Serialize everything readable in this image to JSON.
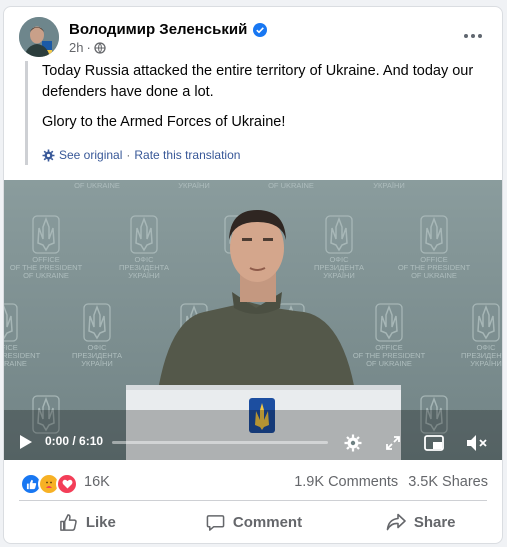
{
  "post": {
    "author": "Володимир Зеленський",
    "time": "2h",
    "verified_icon": "verified-badge-icon",
    "privacy_icon": "globe-icon"
  },
  "translation": {
    "paragraph_1": "Today Russia attacked the entire territory of Ukraine. And today our defenders have done a lot.",
    "paragraph_2": "Glory to the Armed Forces of Ukraine!",
    "see_original": "See original",
    "separator": "·",
    "rate": "Rate this translation"
  },
  "video": {
    "time": "0:00 / 6:10",
    "progress": 0.0,
    "backdrop_lines": [
      "OFFICE",
      "OF THE PRESIDENT",
      "OF UKRAINE"
    ],
    "backdrop_lines_ua": [
      "ОФІС",
      "ПРЕЗИДЕНТА",
      "УКРАЇНИ"
    ],
    "header_strip": [
      "OF UKRAINE",
      "УКРАЇНИ",
      "OF UKRAINE",
      "УКРАЇНИ"
    ]
  },
  "stats": {
    "reactions_count": "16K",
    "comments": "1.9K Comments",
    "shares": "3.5K Shares"
  },
  "actions": {
    "like": "Like",
    "comment": "Comment",
    "share": "Share"
  },
  "colors": {
    "link": "#385898",
    "like_blue": "#1877f2",
    "love_red": "#f33e58",
    "care_yellow": "#f7b125",
    "backdrop": "#7d8f91"
  }
}
